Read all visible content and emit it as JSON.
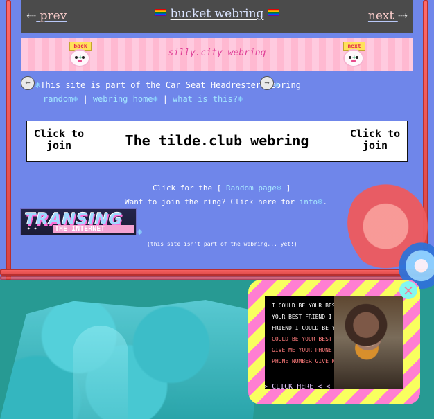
{
  "colors": {
    "page_background": "#6f86ea",
    "top_bar": "#4b4b4b",
    "silly_strip": "#ffcadf",
    "link_blue": "#a8e6ff",
    "popup_yellow": "#f9ff5f",
    "popup_pink": "#ff7ed2",
    "teal_background": "#279a93"
  },
  "top_nav": {
    "prev": {
      "arrow": "⇠",
      "label": "prev"
    },
    "title": "bucket webring",
    "next": {
      "label": "next",
      "arrow": "⇢"
    }
  },
  "silly_city": {
    "title": "silly.city webring",
    "back": "back",
    "next": "next"
  },
  "car_seat_webring": {
    "prefix_snowflake": "❄",
    "text": "This site is part of the Car Seat Headrester webring",
    "suffix_snowflake": "❄",
    "left_button_icon": "←",
    "right_button_icon": "→",
    "links": {
      "random": "random",
      "home": "webring home",
      "about": "what is this?"
    },
    "separator": "|",
    "snowflake": "❄"
  },
  "tilde_webring": {
    "left": "Click to join",
    "title": "The tilde.club webring",
    "right": "Click to join"
  },
  "random_line": {
    "before": "Click for the [",
    "link": "Random page",
    "after": "]"
  },
  "join_line": {
    "before": "Want to join the ring? Click here for",
    "link": "info",
    "after": "."
  },
  "transing_badge": {
    "top": "TRANSING",
    "bottom": "THE INTERNET",
    "sparkles": "✦  ✦"
  },
  "not_part_note": "(this site isn't part of the webring... yet!)",
  "popup": {
    "lines": [
      "I COULD BE YOUR BEST",
      "YOUR BEST FRIEND I",
      "FRIEND I COULD BE Y",
      "COULD BE YOUR BEST",
      "GIVE ME YOUR PHONE",
      "PHONE NUMBER GIVE M"
    ],
    "cta": "> > CLICK HERE < < <",
    "close": "×"
  }
}
